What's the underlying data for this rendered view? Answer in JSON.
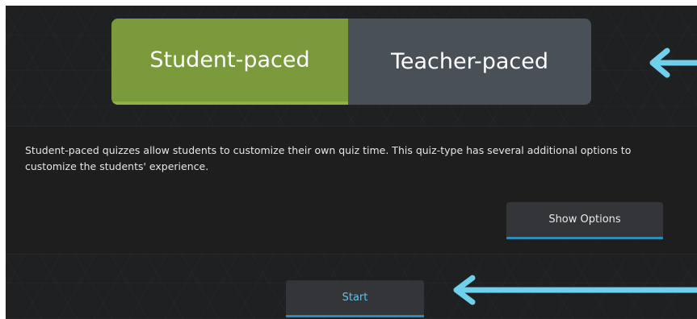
{
  "mode_toggle": {
    "student_label": "Student-paced",
    "teacher_label": "Teacher-paced",
    "selected": "Student-paced"
  },
  "description": "Student-paced quizzes allow students to customize their own quiz time. This quiz-type has several additional options to customize the students' experience.",
  "buttons": {
    "show_options": "Show Options",
    "start": "Start"
  },
  "colors": {
    "background": "#1f2022",
    "student_active": "#7a9a3c",
    "teacher_inactive": "#4a5058",
    "accent_underline": "#2e8bb6",
    "arrow": "#6fd0ec"
  },
  "icons": [
    "arrow-left-icon",
    "arrow-left-icon"
  ]
}
